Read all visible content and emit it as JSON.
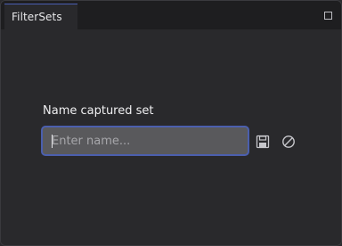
{
  "window": {
    "tab_label": "FilterSets",
    "maximize_icon": "maximize-icon"
  },
  "capture": {
    "label": "Name captured set",
    "input_value": "",
    "input_placeholder": "Enter name...",
    "save_icon": "save-icon",
    "cancel_icon": "cancel-icon"
  },
  "colors": {
    "accent": "#4b5fae",
    "background": "#29292c",
    "input_background": "#59595c"
  }
}
